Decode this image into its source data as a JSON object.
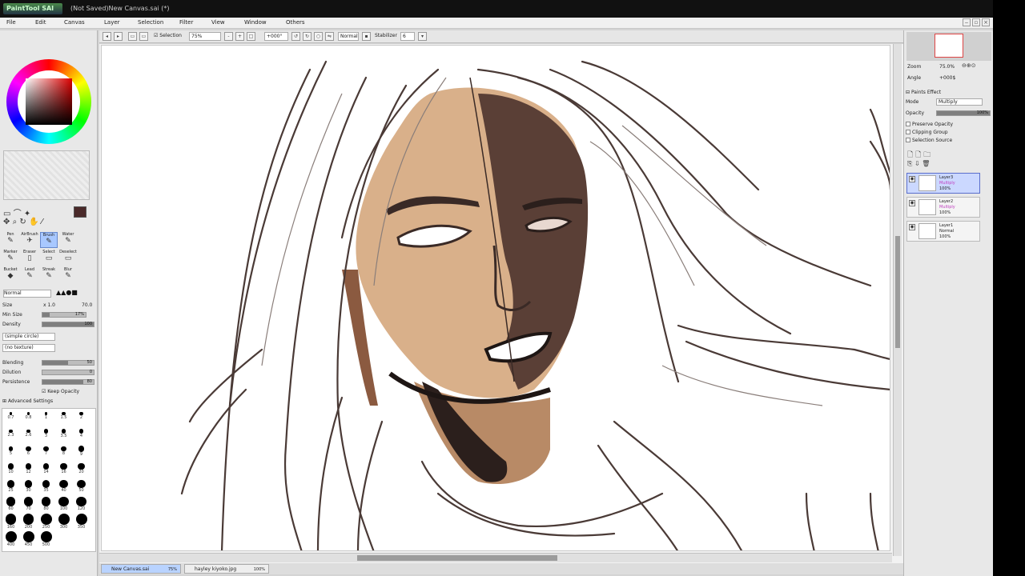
{
  "window": {
    "title": "(Not Saved)New Canvas.sai (*)",
    "logo": "PaintTool SAI"
  },
  "menu": [
    "File",
    "Edit",
    "Canvas",
    "Layer",
    "Selection",
    "Filter",
    "View",
    "Window",
    "Others"
  ],
  "toolbar": {
    "selection_label": "Selection",
    "zoom": "75%",
    "angle": "+000°",
    "blend_mode": "Normal",
    "stabilizer_label": "Stabilizer",
    "stabilizer": "6"
  },
  "brush_settings": {
    "mode": "Normal",
    "size_label": "Size",
    "size_mult": "x 1.0",
    "size_value": "70.0",
    "min_size_label": "Min Size",
    "min_size_value": "17%",
    "min_size_fraction": 0.17,
    "density_label": "Density",
    "density_value": "100",
    "density_fraction": 1.0,
    "shape": "(simple circle)",
    "texture": "(no texture)",
    "blending_label": "Blending",
    "blending_value": "50",
    "blending_fraction": 0.5,
    "dilution_label": "Dilution",
    "dilution_value": "0",
    "dilution_fraction": 0.0,
    "persistence_label": "Persistence",
    "persistence_value": "80",
    "persistence_fraction": 0.8,
    "keep_opacity": "Keep Opacity",
    "advanced": "Advanced Settings"
  },
  "tools": [
    {
      "name": "Pen",
      "glyph": "✎"
    },
    {
      "name": "AirBrush",
      "glyph": "✈"
    },
    {
      "name": "Brush",
      "glyph": "✎",
      "active": true
    },
    {
      "name": "Water",
      "glyph": "✎"
    },
    {
      "name": "Marker",
      "glyph": "✎"
    },
    {
      "name": "Eraser",
      "glyph": "▯"
    },
    {
      "name": "Select",
      "glyph": "▭"
    },
    {
      "name": "Deselect",
      "glyph": "▭"
    },
    {
      "name": "Bucket",
      "glyph": "◆"
    },
    {
      "name": "Lead",
      "glyph": "✎"
    },
    {
      "name": "Streak",
      "glyph": "✎"
    },
    {
      "name": "Blur",
      "glyph": "✎"
    }
  ],
  "brush_sizes": [
    "0.7",
    "0.8",
    "1",
    "1.5",
    "2",
    "2.3",
    "2.6",
    "3",
    "3.5",
    "4",
    "5",
    "6",
    "7",
    "8",
    "9",
    "10",
    "12",
    "14",
    "16",
    "20",
    "25",
    "30",
    "35",
    "40",
    "50",
    "60",
    "70",
    "80",
    "100",
    "120",
    "160",
    "200",
    "250",
    "300",
    "350",
    "400",
    "450",
    "500"
  ],
  "primary_color": "#4a2a2a",
  "navigator": {
    "zoom_label": "Zoom",
    "zoom": "75.0%",
    "angle_label": "Angle",
    "angle": "+000$"
  },
  "layers_panel": {
    "paint_effect": "Paints Effect",
    "mode_label": "Mode",
    "mode": "Multiply",
    "opacity_label": "Opacity",
    "opacity": "100%",
    "preserve_opacity": "Preserve Opacity",
    "clipping_group": "Clipping Group",
    "selection_source": "Selection Source",
    "layers": [
      {
        "name": "Layer3",
        "mode": "Multiply",
        "opacity": "100%",
        "active": true,
        "mode_color": "#c040c0"
      },
      {
        "name": "Layer2",
        "mode": "Multiply",
        "opacity": "100%",
        "active": false,
        "mode_color": "#c040c0"
      },
      {
        "name": "Layer1",
        "mode": "Normal",
        "opacity": "100%",
        "active": false,
        "mode_color": "#222222"
      }
    ]
  },
  "doc_tabs": [
    {
      "name": "New Canvas.sai",
      "zoom": "75%",
      "active": true
    },
    {
      "name": "hayley kiyoko.jpg",
      "zoom": "100%",
      "active": false
    }
  ],
  "colors": {
    "skin_light": "#d9b08a",
    "skin_mid": "#b88a66",
    "skin_shadow": "#5a3f36",
    "line": "#3a2a26"
  }
}
